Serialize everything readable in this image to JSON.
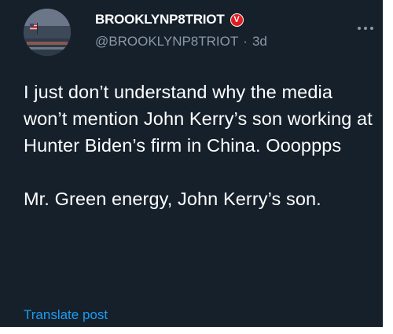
{
  "user": {
    "display_name": "BROOKLYNP8TRIOT",
    "badge_letter": "V",
    "badge_color": "#e11d20",
    "handle": "@BROOKLYNP8TRIOT",
    "separator": "·",
    "timestamp": "3d"
  },
  "tweet": {
    "paragraphs": [
      "I just don’t understand why the media won’t mention John Kerry’s son working at Hunter Biden’s firm in China. Oooppps",
      "Mr. Green energy, John Kerry’s son."
    ]
  },
  "translate_label": "Translate post",
  "icons": {
    "more": "more-horizontal-icon",
    "badge": "verified-badge-icon"
  },
  "colors": {
    "background": "#15202b",
    "text": "#ffffff",
    "secondary_text": "#8b98a5",
    "link": "#1d9bf0"
  }
}
